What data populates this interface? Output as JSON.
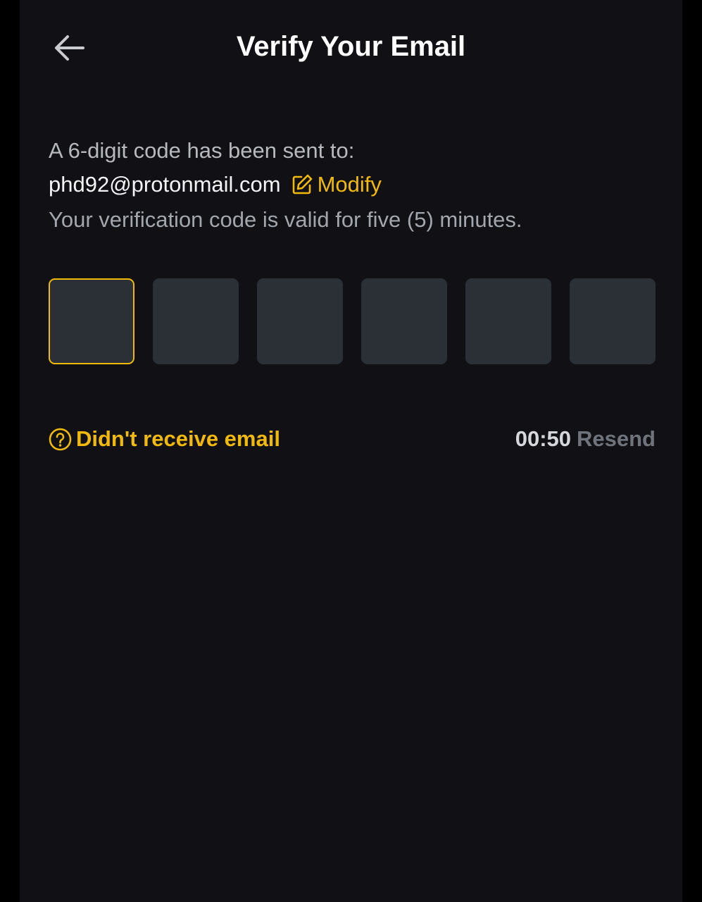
{
  "header": {
    "title": "Verify Your Email",
    "back_icon": "arrow-left-icon"
  },
  "info": {
    "sent_text": "A 6-digit code has been sent to:",
    "email": "phd92@protonmail.com",
    "modify_label": "Modify",
    "modify_icon": "edit-icon",
    "validity_text": "Your verification code is valid for five (5) minutes."
  },
  "code_input": {
    "digits": [
      "",
      "",
      "",
      "",
      "",
      ""
    ],
    "active_index": 0
  },
  "footer": {
    "help_icon": "question-circle-icon",
    "help_label": "Didn't receive email",
    "timer": "00:50",
    "resend_label": "Resend"
  },
  "colors": {
    "background": "#111115",
    "accent": "#f0b90b",
    "box": "#2b2f36",
    "text_primary": "#ffffff",
    "text_secondary": "#b7b9bf",
    "text_disabled": "#6f737b"
  }
}
